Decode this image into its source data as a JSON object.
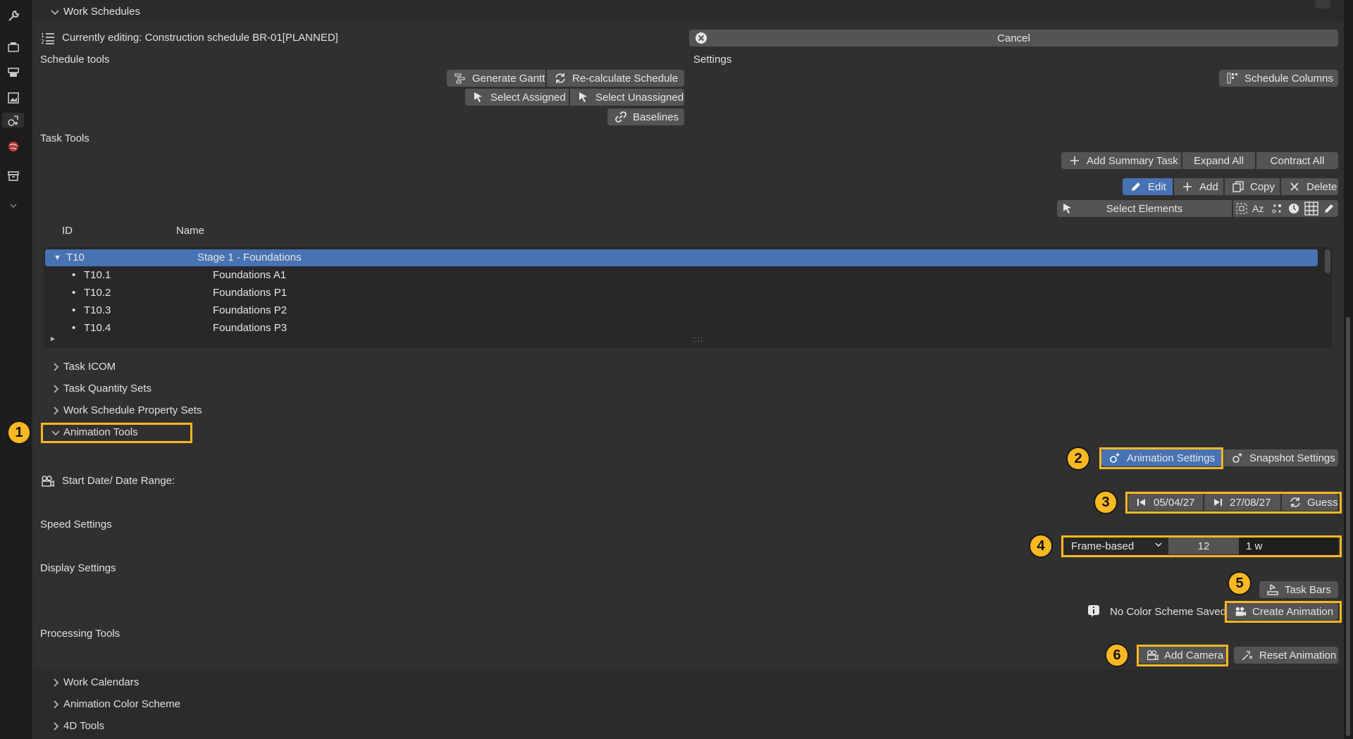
{
  "sidebar": {
    "icons": [
      "tool-icon",
      "scene-icon",
      "render-icon",
      "output-icon",
      "physics-icon",
      "world-icon",
      "collection-icon",
      "chevron-down-icon"
    ]
  },
  "work_schedules": {
    "header": "Work Schedules",
    "currently_editing": "Currently editing: Construction schedule BR-01[PLANNED]",
    "cancel_label": "Cancel",
    "schedule_tools_label": "Schedule tools",
    "settings_label": "Settings",
    "generate_gantt": "Generate Gantt",
    "recalculate_schedule": "Re-calculate Schedule",
    "select_assigned": "Select Assigned",
    "select_unassigned": "Select Unassigned",
    "baselines": "Baselines",
    "schedule_columns": "Schedule Columns"
  },
  "task_tools": {
    "label": "Task Tools",
    "add_summary_task": "Add Summary Task",
    "expand_all": "Expand All",
    "contract_all": "Contract All",
    "edit": "Edit",
    "add": "Add",
    "copy": "Copy",
    "delete": "Delete",
    "select_elements": "Select Elements",
    "az": "Az"
  },
  "task_list": {
    "columns": [
      "ID",
      "Name"
    ],
    "rows": [
      {
        "id": "T10",
        "name": "Stage 1 - Foundations",
        "selected": true,
        "level": 0
      },
      {
        "id": "T10.1",
        "name": "Foundations A1",
        "level": 1
      },
      {
        "id": "T10.2",
        "name": "Foundations P1",
        "level": 1
      },
      {
        "id": "T10.3",
        "name": "Foundations P2",
        "level": 1
      },
      {
        "id": "T10.4",
        "name": "Foundations P3",
        "level": 1
      }
    ],
    "grip": "::::"
  },
  "collapsed_sections": [
    "Task ICOM",
    "Task Quantity Sets",
    "Work Schedule Property Sets"
  ],
  "animation_tools": {
    "header": "Animation Tools",
    "animation_settings": "Animation Settings",
    "snapshot_settings": "Snapshot Settings",
    "start_date_label": "Start Date/ Date Range:",
    "start_date": "05/04/27",
    "end_date": "27/08/27",
    "guess": "Guess",
    "speed_settings_label": "Speed Settings",
    "speed_mode": "Frame-based",
    "speed_frames": "12",
    "speed_duration": "1 w",
    "display_settings_label": "Display Settings",
    "task_bars": "Task Bars",
    "no_color_scheme": "No Color Scheme Saved",
    "create_animation": "Create Animation",
    "processing_tools_label": "Processing Tools",
    "add_camera": "Add Camera",
    "reset_animation": "Reset Animation"
  },
  "bottom_sections": [
    "Work Calendars",
    "Animation Color Scheme",
    "4D Tools"
  ],
  "callouts": [
    "1",
    "2",
    "3",
    "4",
    "5",
    "6"
  ],
  "colors": {
    "highlight": "#f7b821",
    "selection": "#4772b3",
    "panel": "#2b2b2b",
    "button": "#545454"
  }
}
